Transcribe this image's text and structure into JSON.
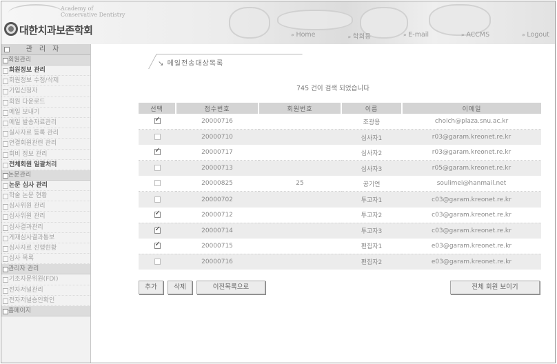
{
  "header": {
    "logo_sub_line1": "Academy of",
    "logo_sub_line2": "Conservative Dentistry",
    "logo_text": "대한치과보존학회",
    "nav": [
      "Home",
      "학회용",
      "E-mail",
      "ACCMS",
      "Logout"
    ]
  },
  "sidebar": {
    "title": "관리자",
    "sections": [
      {
        "label": "회원관리",
        "items": [
          {
            "label": "회원정보 관리",
            "bold": true
          },
          {
            "label": "회원정보 수정/삭제",
            "bold": false
          },
          {
            "label": "가입신청자",
            "bold": false
          },
          {
            "label": "회원 다운로드",
            "bold": false
          },
          {
            "label": "메일 보내기",
            "bold": false
          },
          {
            "label": "메일 발송자료관리",
            "bold": false
          },
          {
            "label": "실사자료 등록 관리",
            "bold": false
          },
          {
            "label": "연결회원관련 관리",
            "bold": false
          },
          {
            "label": "회비 정보 관리",
            "bold": false
          },
          {
            "label": "전체회원 일괄처리",
            "bold": true
          }
        ]
      },
      {
        "label": "논문관리",
        "items": [
          {
            "label": "논문 심사 관리",
            "bold": true
          },
          {
            "label": "학술 논문 현황",
            "bold": false
          },
          {
            "label": "심사위원 관리",
            "bold": false
          },
          {
            "label": "심사위원 관리",
            "bold": false
          },
          {
            "label": "심사결과관리",
            "bold": false
          },
          {
            "label": "게재심사결과통보",
            "bold": false
          },
          {
            "label": "심사자료 진행현황",
            "bold": false
          },
          {
            "label": "심사 목록",
            "bold": false
          }
        ]
      },
      {
        "label": "관리자 관리",
        "items": [
          {
            "label": "기조자문위원(FDI)",
            "bold": false
          },
          {
            "label": "전자저널관리",
            "bold": false
          },
          {
            "label": "전자저널승인확인",
            "bold": false
          }
        ]
      },
      {
        "label": "홈페이지",
        "items": []
      }
    ]
  },
  "main": {
    "title": "메일전송대상목록",
    "count_text": "745 건이 검색 되었습니다",
    "columns": [
      "선택",
      "접수번호",
      "회원번호",
      "이름",
      "이메일"
    ],
    "rows": [
      {
        "checked": true,
        "id": "20000716",
        "member": "",
        "name": "조광용",
        "email": "choich@plaza.snu.ac.kr"
      },
      {
        "checked": false,
        "id": "20000710",
        "member": "",
        "name": "심사자1",
        "email": "r03@garam.kreonet.re.kr"
      },
      {
        "checked": true,
        "id": "20000717",
        "member": "",
        "name": "심사자2",
        "email": "r03@garam.kreonet.re.kr"
      },
      {
        "checked": false,
        "id": "20000713",
        "member": "",
        "name": "심사자3",
        "email": "r05@garam.kreonet.re.kr"
      },
      {
        "checked": false,
        "id": "20000825",
        "member": "25",
        "name": "공기연",
        "email": "soulimei@hanmail.net"
      },
      {
        "checked": false,
        "id": "20000702",
        "member": "",
        "name": "투고자1",
        "email": "c03@garam.kreonet.re.kr"
      },
      {
        "checked": true,
        "id": "20000712",
        "member": "",
        "name": "투고자2",
        "email": "c03@garam.kreonet.re.kr"
      },
      {
        "checked": true,
        "id": "20000714",
        "member": "",
        "name": "투고자3",
        "email": "c03@garam.kreonet.re.kr"
      },
      {
        "checked": true,
        "id": "20000715",
        "member": "",
        "name": "편집자1",
        "email": "e03@garam.kreonet.re.kr"
      },
      {
        "checked": false,
        "id": "20000716",
        "member": "",
        "name": "편집자2",
        "email": "e03@garam.kreonet.re.kr"
      }
    ],
    "buttons": {
      "add": "추가",
      "delete": "삭제",
      "recipient_list": "이전목록으로",
      "show_all": "전체 회원 보이기"
    }
  }
}
